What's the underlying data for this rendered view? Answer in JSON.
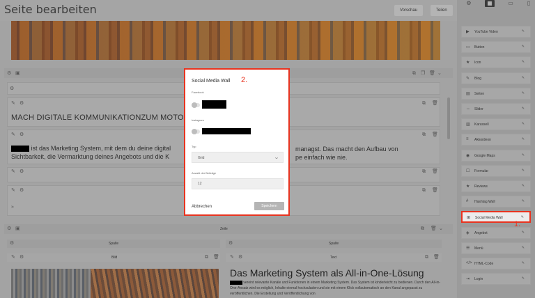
{
  "header": {
    "title": "Seite bearbeiten",
    "preview_label": "Vorschau",
    "share_label": "Teilen"
  },
  "content": {
    "heading": "MACH DIGITALE KOMMUNIKATIONZUM MOTOR D",
    "paragraph_line1": "ist das Marketing System, mit dem du deine digital",
    "paragraph_line1_tail": "managst. Das macht den Aufbau von",
    "paragraph_line2": "Sichtbarkeit, die Vermarktung deines Angebots und die K",
    "paragraph_line2_tail": "pe einfach wie nie.",
    "zeile_label": "Zeile",
    "spalte_left": "Spalte",
    "spalte_right": "Spalte",
    "bild_label": "Bild",
    "text_label": "Text",
    "heading2": "Das Marketing System als All-in-One-Lösung",
    "small_text": "vereint relevante Kanäle und Funktionen in einem Marketing System. Das System ist kinderleicht zu bedienen. Durch den All-in-One-Ansatz wird es möglich, Inhalte einmal hochzuladen und sie mit einem Klick vollautomatisch an den Kanal angepasst zu veröffentlichen. Die Erstellung und Veröffentlichung von"
  },
  "modal": {
    "title": "Social Media Wall",
    "step_marker": "2.",
    "facebook_label": "Facebook",
    "instagram_label": "Instagram",
    "type_label": "Typ",
    "type_value": "Grid",
    "count_label": "Anzahl der Beiträge",
    "count_value": "12",
    "cancel_label": "Abbrechen",
    "save_label": "Speichern"
  },
  "panel": {
    "step_marker": "1.",
    "widgets": [
      {
        "label": "YouTube Video",
        "icon": "youtube-icon"
      },
      {
        "label": "Button",
        "icon": "button-icon"
      },
      {
        "label": "Icon",
        "icon": "star-icon"
      },
      {
        "label": "Blog",
        "icon": "pen-icon"
      },
      {
        "label": "Seiten",
        "icon": "pages-icon"
      },
      {
        "label": "Slider",
        "icon": "slider-icon"
      },
      {
        "label": "Karussell",
        "icon": "carousel-icon"
      },
      {
        "label": "Akkordeon",
        "icon": "accordion-icon"
      },
      {
        "label": "Google Maps",
        "icon": "map-pin-icon"
      },
      {
        "label": "Formular",
        "icon": "form-icon"
      },
      {
        "label": "Reviews",
        "icon": "star-icon"
      },
      {
        "label": "Hashtag Wall",
        "icon": "hashtag-icon"
      },
      {
        "label": "Social Media Wall",
        "icon": "grid-icon"
      },
      {
        "label": "Angebot",
        "icon": "offer-icon"
      },
      {
        "label": "Menü",
        "icon": "menu-icon"
      },
      {
        "label": "HTML-Code",
        "icon": "code-icon"
      },
      {
        "label": "Login",
        "icon": "login-icon"
      }
    ]
  }
}
